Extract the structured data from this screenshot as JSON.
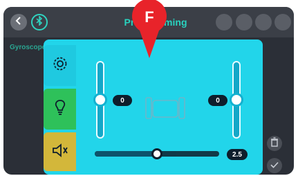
{
  "topbar": {
    "title": "Programming"
  },
  "side_label": "Gyroscope",
  "tabs": [
    {
      "icon": "gear-icon",
      "color": "#1fc9e0"
    },
    {
      "icon": "light-bulb-icon",
      "color": "#2ec15a"
    },
    {
      "icon": "speaker-icon",
      "color": "#d3b73a"
    }
  ],
  "controls": {
    "left_slider_value": "0",
    "right_slider_value": "0",
    "duration_value": "2.5",
    "duration_fraction": 0.5
  },
  "marker": {
    "letter": "F",
    "color": "#e8232a"
  },
  "colors": {
    "accent": "#29d3bf",
    "panel": "#22d5ea"
  }
}
